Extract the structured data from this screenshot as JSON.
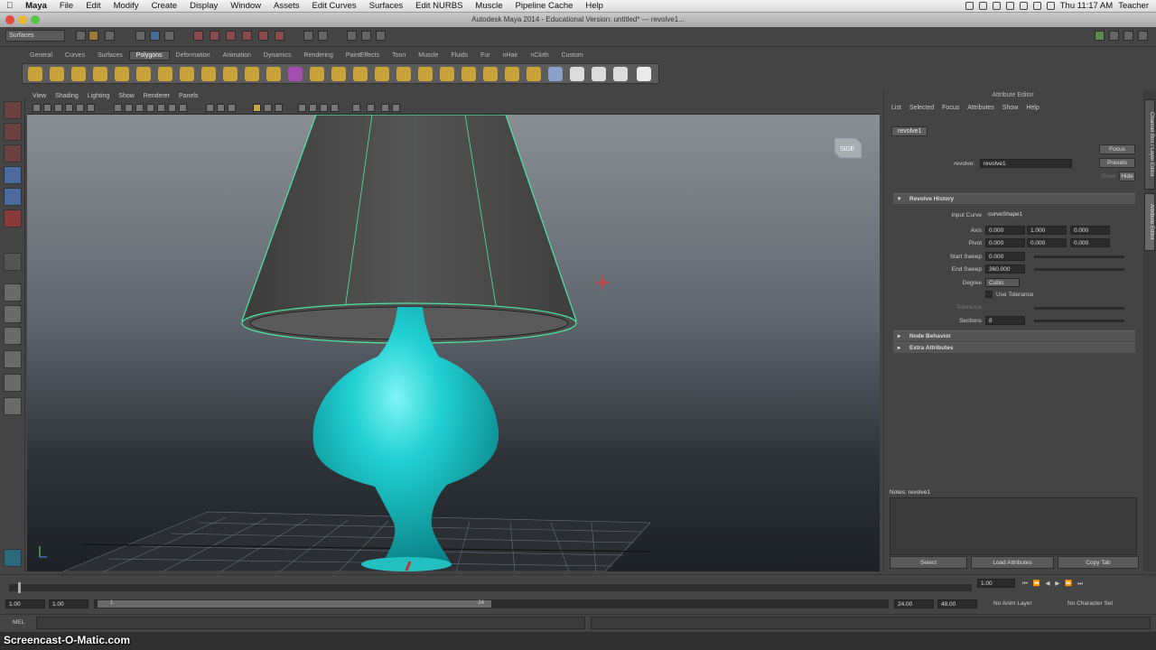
{
  "menubar": {
    "app": "Maya",
    "items": [
      "File",
      "Edit",
      "Modify",
      "Create",
      "Display",
      "Window",
      "Assets",
      "Edit Curves",
      "Surfaces",
      "Edit NURBS",
      "Muscle",
      "Pipeline Cache",
      "Help"
    ],
    "clock": "Thu 11:17 AM",
    "user": "Teacher"
  },
  "window": {
    "title": "Autodesk Maya 2014 - Educational Version: untitled*   ---   revolve1..."
  },
  "status_line": {
    "menu_set": "Surfaces"
  },
  "shelf": {
    "tabs": [
      "General",
      "Curves",
      "Surfaces",
      "Polygons",
      "Deformation",
      "Animation",
      "Dynamics",
      "Rendering",
      "PaintEffects",
      "Toon",
      "Muscle",
      "Fluids",
      "Fur",
      "nHair",
      "nCloth",
      "Custom"
    ],
    "active_tab": "Polygons"
  },
  "viewport": {
    "menu": [
      "View",
      "Shading",
      "Lighting",
      "Show",
      "Renderer",
      "Panels"
    ],
    "viewcube_label": "SIDE"
  },
  "attribute_editor": {
    "title": "Attribute Editor",
    "menu": [
      "List",
      "Selected",
      "Focus",
      "Attributes",
      "Show",
      "Help"
    ],
    "node_tab": "revolve1",
    "node_label": "revolve:",
    "node_value": "revolve1",
    "focus_btn": "Focus",
    "presets_btn": "Presets",
    "show_label": "Show",
    "hide_btn": "Hide",
    "section_history": "Revolve History",
    "input_curve_label": "Input Curve",
    "input_curve_value": "curveShape1",
    "axis_label": "Axis",
    "axis_values": [
      "0.000",
      "1.000",
      "0.000"
    ],
    "pivot_label": "Pivot",
    "pivot_values": [
      "0.000",
      "0.000",
      "0.000"
    ],
    "start_sweep_label": "Start Sweep",
    "start_sweep_value": "0.000",
    "end_sweep_label": "End Sweep",
    "end_sweep_value": "360.000",
    "degree_label": "Degree",
    "degree_value": "Cubic",
    "use_tolerance_label": "Use Tolerance",
    "tolerance_label": "Tolerance",
    "sections_label": "Sections",
    "sections_value": "8",
    "section_node_behavior": "Node Behavior",
    "section_extra": "Extra Attributes",
    "notes_label": "Notes:  revolve1",
    "btn_select": "Select",
    "btn_load": "Load Attributes",
    "btn_copy": "Copy Tab",
    "side_tabs": [
      "Channel Box / Layer Editor",
      "Attribute Editor"
    ]
  },
  "timeline": {
    "current_frame": "1.00",
    "start_value": "1.00",
    "start_inner": "1.00",
    "range_start_label": "1",
    "range_end_label": "24",
    "end_inner": "24.00",
    "end_value": "48.00",
    "anim_layer": "No Anim Layer",
    "char_set": "No Character Set"
  },
  "command_line": {
    "label": "MEL"
  },
  "watermark": "Screencast-O-Matic.com",
  "colors": {
    "lamp_base": "#1ec8c8",
    "selection": "#4de8a0"
  }
}
